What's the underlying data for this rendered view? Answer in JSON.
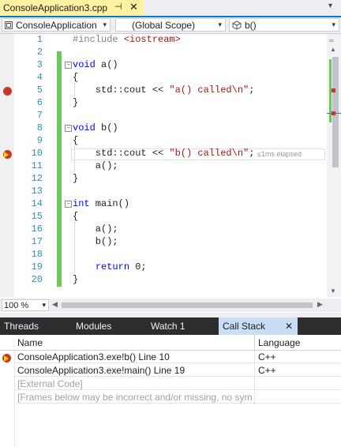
{
  "doc_tab": {
    "title": "ConsoleApplication3.cpp",
    "pin": "⊣",
    "close": "✕"
  },
  "tabstrip_dropdown": "▾",
  "navbar": {
    "project": "ConsoleApplication",
    "scope": "(Global Scope)",
    "member": "b()",
    "dropdown_arrow": "▾"
  },
  "editor": {
    "line_numbers": [
      "1",
      "2",
      "3",
      "4",
      "5",
      "6",
      "7",
      "8",
      "9",
      "10",
      "11",
      "12",
      "13",
      "14",
      "15",
      "16",
      "17",
      "18",
      "19",
      "20"
    ],
    "perf_tip": "≤1ms elapsed",
    "breakpoint_lines": [
      5,
      10
    ],
    "current_line": 10
  },
  "code": {
    "l1_pp": "#include ",
    "l1_inc": "<iostream>",
    "l3_kw": "void",
    "l3_rest": " a()",
    "l4": "{",
    "l5_pre": "    std::cout << ",
    "l5_str": "\"a() called\\n\"",
    "l5_post": ";",
    "l6": "}",
    "l8_kw": "void",
    "l8_rest": " b()",
    "l9": "{",
    "l10_pre": "    std::cout << ",
    "l10_str": "\"b() called\\n\"",
    "l10_post": ";",
    "l11": "    a();",
    "l12": "}",
    "l14_kw": "int",
    "l14_rest": " main()",
    "l15": "{",
    "l16": "    a();",
    "l17": "    b();",
    "l19_indent": "    ",
    "l19_kw": "return",
    "l19_rest": " 0;",
    "l20": "}"
  },
  "bottom_bar": {
    "zoom": "100 %",
    "arrow": "▾",
    "left": "◀",
    "right": "▶"
  },
  "tool_tabs": {
    "threads": "Threads",
    "modules": "Modules",
    "watch": "Watch 1",
    "callstack": "Call Stack",
    "close": "✕"
  },
  "call_stack": {
    "headers": {
      "name": "Name",
      "language": "Language"
    },
    "rows": [
      {
        "name": "ConsoleApplication3.exe!b() Line 10",
        "language": "C++"
      },
      {
        "name": "ConsoleApplication3.exe!main() Line 19",
        "language": "C++"
      },
      {
        "name": "[External Code]",
        "language": ""
      },
      {
        "name": "[Frames below may be incorrect and/or missing, no symb",
        "language": ""
      }
    ]
  },
  "colors": {
    "accent": "#007acc",
    "active_tab": "#fef1a2",
    "breakpoint": "#c4382d",
    "keyword": "#0000ff",
    "string": "#a31515",
    "line_number": "#2b91af",
    "change_bar": "#6cc85d"
  },
  "icons": {
    "scope_icon": "cube-icon",
    "project_icon": "project-icon"
  }
}
